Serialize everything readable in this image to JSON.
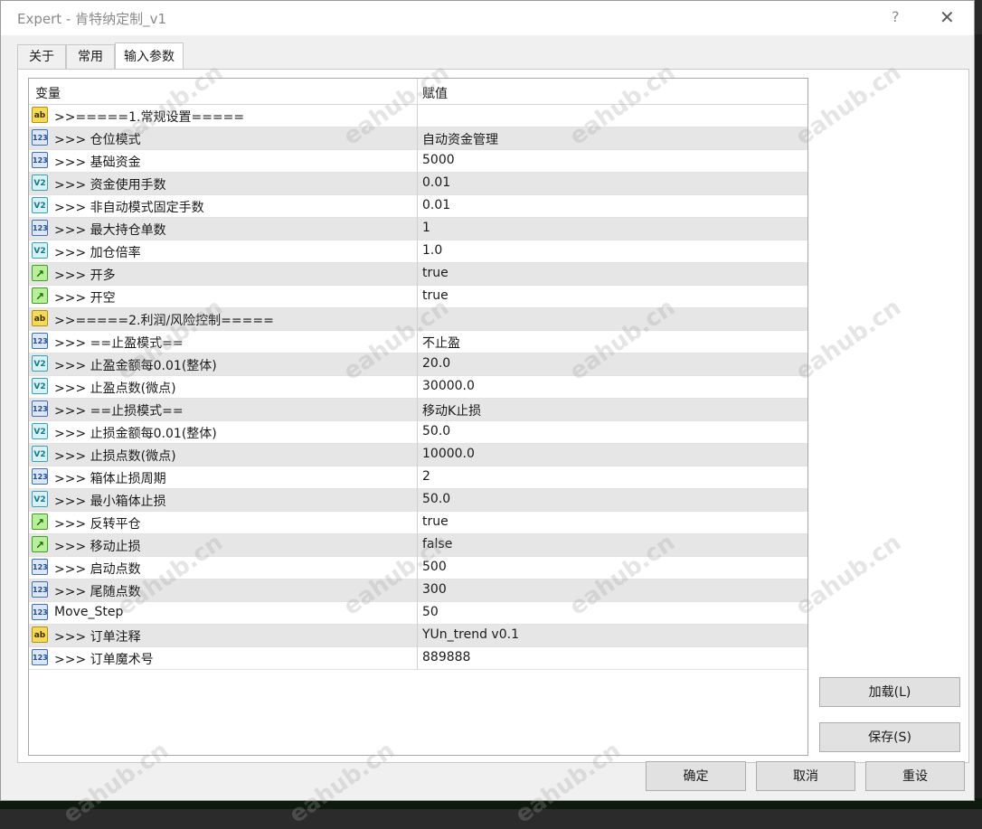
{
  "window": {
    "title": "Expert - 肯特纳定制_v1",
    "help_label": "?",
    "close_label": "✕"
  },
  "tabs": [
    {
      "label": "关于"
    },
    {
      "label": "常用"
    },
    {
      "label": "输入参数"
    }
  ],
  "grid": {
    "col_variable": "变量",
    "col_value": "赋值",
    "rows": [
      {
        "type": "ab",
        "name": ">>=====1.常规设置=====",
        "value": ""
      },
      {
        "type": "123",
        "name": ">>>  仓位模式",
        "value": "自动资金管理"
      },
      {
        "type": "123",
        "name": ">>>  基础资金",
        "value": "5000"
      },
      {
        "type": "v2",
        "name": ">>>  资金使用手数",
        "value": "0.01"
      },
      {
        "type": "v2",
        "name": ">>>  非自动模式固定手数",
        "value": "0.01"
      },
      {
        "type": "123",
        "name": ">>>  最大持仓单数",
        "value": "1"
      },
      {
        "type": "v2",
        "name": ">>>  加仓倍率",
        "value": "1.0"
      },
      {
        "type": "bool",
        "name": ">>>  开多",
        "value": "true"
      },
      {
        "type": "bool",
        "name": ">>>  开空",
        "value": "true"
      },
      {
        "type": "ab",
        "name": ">>=====2.利润/风险控制=====",
        "value": ""
      },
      {
        "type": "123",
        "name": ">>>  ==止盈模式==",
        "value": "不止盈"
      },
      {
        "type": "v2",
        "name": ">>>  止盈金额每0.01(整体)",
        "value": "20.0"
      },
      {
        "type": "v2",
        "name": ">>>  止盈点数(微点)",
        "value": "30000.0"
      },
      {
        "type": "123",
        "name": ">>>  ==止损模式==",
        "value": "移动K止损"
      },
      {
        "type": "v2",
        "name": ">>>  止损金额每0.01(整体)",
        "value": "50.0"
      },
      {
        "type": "v2",
        "name": ">>>  止损点数(微点)",
        "value": "10000.0"
      },
      {
        "type": "123",
        "name": ">>>  箱体止损周期",
        "value": "2"
      },
      {
        "type": "v2",
        "name": ">>>  最小箱体止损",
        "value": "50.0"
      },
      {
        "type": "bool",
        "name": ">>>  反转平仓",
        "value": "true"
      },
      {
        "type": "bool",
        "name": ">>>  移动止损",
        "value": "false"
      },
      {
        "type": "123",
        "name": ">>>  启动点数",
        "value": "500"
      },
      {
        "type": "123",
        "name": ">>>  尾随点数",
        "value": "300"
      },
      {
        "type": "123",
        "name": "Move_Step",
        "value": "50"
      },
      {
        "type": "ab",
        "name": ">>>  订单注释",
        "value": "YUn_trend v0.1"
      },
      {
        "type": "123",
        "name": ">>>  订单魔术号",
        "value": "889888"
      }
    ]
  },
  "type_icons": {
    "ab": "ab",
    "123": "123",
    "v2": "V2",
    "bool": "↗"
  },
  "buttons": {
    "load": "加载(L)",
    "save": "保存(S)",
    "ok": "确定",
    "cancel": "取消",
    "reset": "重设"
  },
  "watermark": "eahub.cn"
}
